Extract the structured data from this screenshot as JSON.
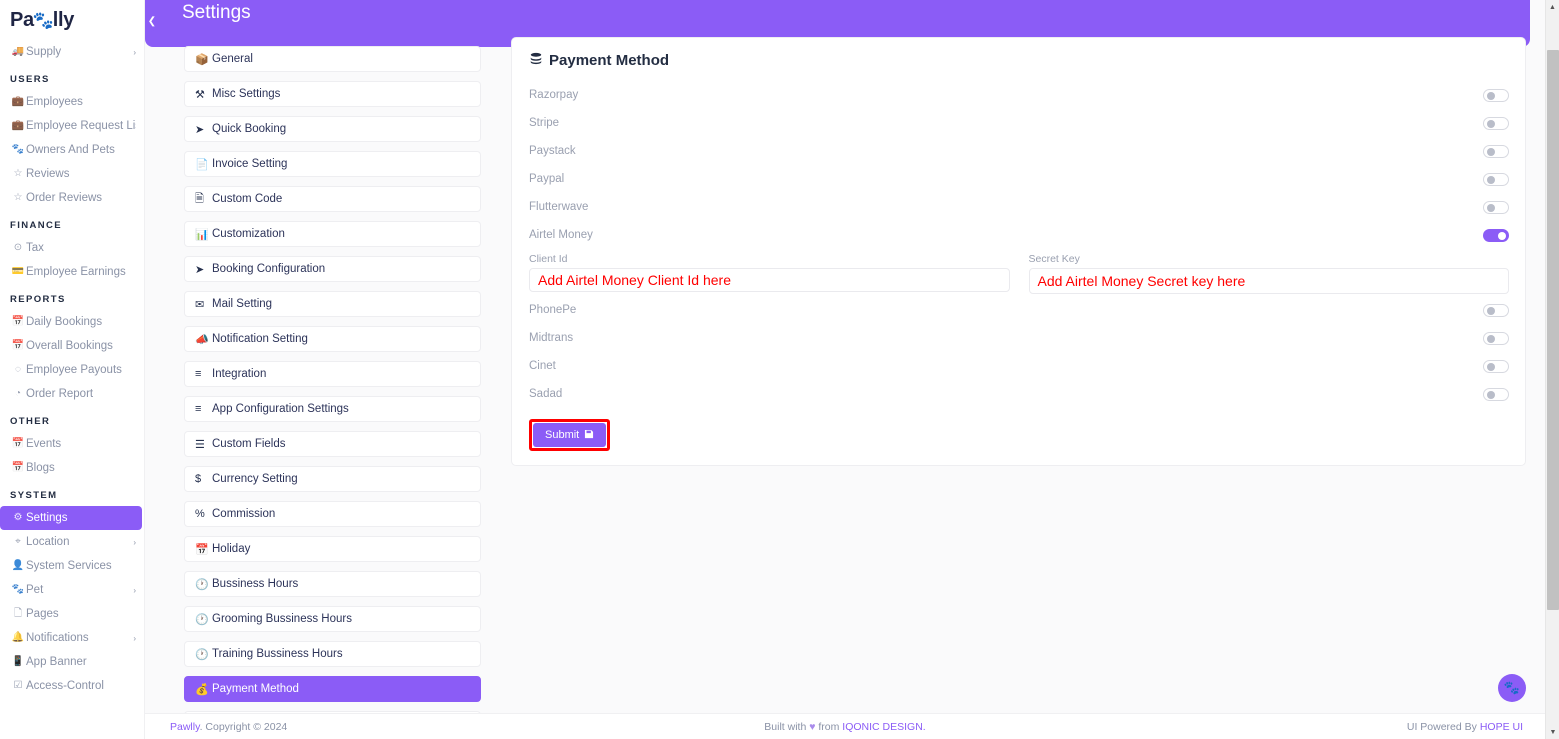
{
  "brand": {
    "pre": "Pa",
    "paw_icon": "paw-icon",
    "post": "lly"
  },
  "header": {
    "title": "Settings",
    "collapse_icon": "chevron-left-icon"
  },
  "sidebar": {
    "groups": [
      {
        "label": "",
        "items": [
          {
            "label": "Supply",
            "icon": "truck-icon",
            "caret": "›",
            "active": false
          }
        ]
      },
      {
        "label": "USERS",
        "items": [
          {
            "label": "Employees",
            "icon": "briefcase-icon",
            "caret": "",
            "active": false
          },
          {
            "label": "Employee Request List",
            "icon": "briefcase-icon",
            "caret": "",
            "active": false
          },
          {
            "label": "Owners And Pets",
            "icon": "paw-icon",
            "caret": "",
            "active": false
          },
          {
            "label": "Reviews",
            "icon": "star-icon",
            "caret": "",
            "active": false
          },
          {
            "label": "Order Reviews",
            "icon": "star-icon",
            "caret": "",
            "active": false
          }
        ]
      },
      {
        "label": "FINANCE",
        "items": [
          {
            "label": "Tax",
            "icon": "percent-circle-icon",
            "caret": "",
            "active": false
          },
          {
            "label": "Employee Earnings",
            "icon": "wallet-icon",
            "caret": "",
            "active": false
          }
        ]
      },
      {
        "label": "REPORTS",
        "items": [
          {
            "label": "Daily Bookings",
            "icon": "calendar-icon",
            "caret": "",
            "active": false
          },
          {
            "label": "Overall Bookings",
            "icon": "calendar-icon",
            "caret": "",
            "active": false
          },
          {
            "label": "Employee Payouts",
            "icon": "dashed-circle-icon",
            "caret": "",
            "active": false
          },
          {
            "label": "Order Report",
            "icon": "pie-chart-icon",
            "caret": "",
            "active": false
          }
        ]
      },
      {
        "label": "OTHER",
        "items": [
          {
            "label": "Events",
            "icon": "calendar-icon",
            "caret": "",
            "active": false
          },
          {
            "label": "Blogs",
            "icon": "calendar-icon",
            "caret": "",
            "active": false
          }
        ]
      },
      {
        "label": "SYSTEM",
        "items": [
          {
            "label": "Settings",
            "icon": "gear-icon",
            "caret": "",
            "active": true
          },
          {
            "label": "Location",
            "icon": "map-pin-icon",
            "caret": "›",
            "active": false
          },
          {
            "label": "System Services",
            "icon": "user-gear-icon",
            "caret": "",
            "active": false
          },
          {
            "label": "Pet",
            "icon": "paw-icon",
            "caret": "›",
            "active": false
          },
          {
            "label": "Pages",
            "icon": "file-icon",
            "caret": "",
            "active": false
          },
          {
            "label": "Notifications",
            "icon": "bell-icon",
            "caret": "›",
            "active": false
          },
          {
            "label": "App Banner",
            "icon": "mobile-icon",
            "caret": "",
            "active": false
          },
          {
            "label": "Access-Control",
            "icon": "shield-check-icon",
            "caret": "",
            "active": false
          }
        ]
      }
    ]
  },
  "settings_menu": {
    "items": [
      {
        "label": "General",
        "icon": "box-icon",
        "active": false
      },
      {
        "label": "Misc Settings",
        "icon": "tools-icon",
        "active": false
      },
      {
        "label": "Quick Booking",
        "icon": "paper-plane-icon",
        "active": false
      },
      {
        "label": "Invoice Setting",
        "icon": "invoice-icon",
        "active": false
      },
      {
        "label": "Custom Code",
        "icon": "code-file-icon",
        "active": false
      },
      {
        "label": "Customization",
        "icon": "customize-icon",
        "active": false
      },
      {
        "label": "Booking Configuration",
        "icon": "paper-plane-icon",
        "active": false
      },
      {
        "label": "Mail Setting",
        "icon": "envelope-icon",
        "active": false
      },
      {
        "label": "Notification Setting",
        "icon": "megaphone-icon",
        "active": false
      },
      {
        "label": "Integration",
        "icon": "sliders-icon",
        "active": false
      },
      {
        "label": "App Configuration Settings",
        "icon": "sliders-icon",
        "active": false
      },
      {
        "label": "Custom Fields",
        "icon": "list-icon",
        "active": false
      },
      {
        "label": "Currency Setting",
        "icon": "dollar-icon",
        "active": false
      },
      {
        "label": "Commission",
        "icon": "percent-icon",
        "active": false
      },
      {
        "label": "Holiday",
        "icon": "calendar-icon",
        "active": false
      },
      {
        "label": "Bussiness Hours",
        "icon": "clock-icon",
        "active": false
      },
      {
        "label": "Grooming Bussiness Hours",
        "icon": "clock-icon",
        "active": false
      },
      {
        "label": "Training Bussiness Hours",
        "icon": "clock-icon",
        "active": false
      },
      {
        "label": "Payment Method",
        "icon": "coins-icon",
        "active": true
      },
      {
        "label": "",
        "icon": "",
        "active": false
      }
    ]
  },
  "payment_panel": {
    "title": "Payment Method",
    "title_icon": "coins-icon",
    "methods": [
      {
        "label": "Razorpay",
        "enabled": false
      },
      {
        "label": "Stripe",
        "enabled": false
      },
      {
        "label": "Paystack",
        "enabled": false
      },
      {
        "label": "Paypal",
        "enabled": false
      },
      {
        "label": "Flutterwave",
        "enabled": false
      },
      {
        "label": "Airtel Money",
        "enabled": true
      }
    ],
    "airtel_fields": {
      "client_id": {
        "label": "Client Id",
        "value": "Add Airtel Money Client Id here"
      },
      "secret_key": {
        "label": "Secret Key",
        "value": "Add Airtel Money Secret key here"
      }
    },
    "methods_after": [
      {
        "label": "PhonePe",
        "enabled": false
      },
      {
        "label": "Midtrans",
        "enabled": false
      },
      {
        "label": "Cinet",
        "enabled": false
      },
      {
        "label": "Sadad",
        "enabled": false
      }
    ],
    "submit": {
      "label": "Submit",
      "icon": "save-icon"
    },
    "accent_color": "#8b5cf6",
    "highlight_color": "#ff0000"
  },
  "footer": {
    "brand": "Pawlly",
    "copyright": ". Copyright © 2024",
    "built_pre": "Built with ",
    "built_heart": "♥",
    "built_mid": " from ",
    "built_brand": "IQONIC DESIGN.",
    "powered_pre": "UI Powered By ",
    "powered_brand": "HOPE UI"
  },
  "fab": {
    "icon": "paw-icon"
  }
}
